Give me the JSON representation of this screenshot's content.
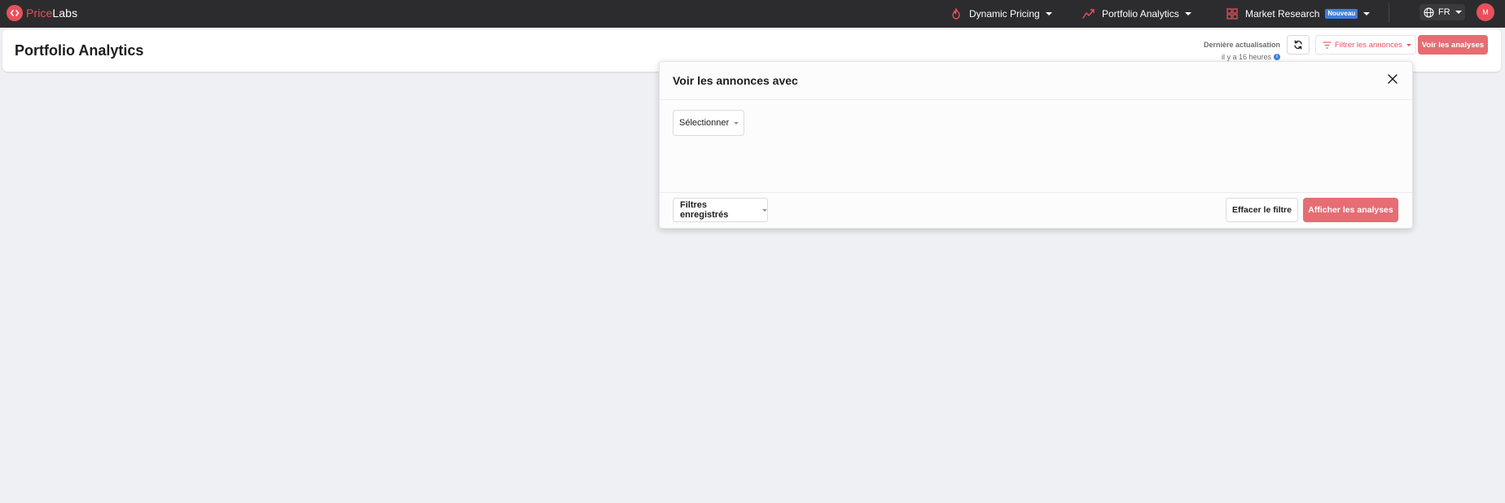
{
  "brand": {
    "name_part1": "Price",
    "name_part2": "Labs",
    "logo_icon": "code-brackets-icon",
    "color": "#e8505b"
  },
  "nav": {
    "items": [
      {
        "label": "Dynamic Pricing",
        "icon": "flame-icon"
      },
      {
        "label": "Portfolio Analytics",
        "icon": "trend-line-icon"
      },
      {
        "label": "Market Research",
        "icon": "grid-icon",
        "badge": "Nouveau"
      }
    ],
    "language": "FR",
    "avatar_initial": "M"
  },
  "header": {
    "title": "Portfolio Analytics",
    "last_update_label": "Dernière actualisation",
    "last_update_time": "il y a 16 heures",
    "info_symbol": "i",
    "filter_label": "Filtrer les annonces",
    "view_label": "Voir les analyses"
  },
  "popover": {
    "title": "Voir les annonces avec",
    "select_label": "Sélectionner",
    "saved_filters_label": "Filtres enregistrés",
    "clear_label": "Effacer le filtre",
    "show_label": "Afficher les analyses"
  },
  "colors": {
    "accent": "#e8505b",
    "accent_button": "#e56d73",
    "navbar": "#2c2c2e",
    "badge": "#3d7fe0",
    "background": "#eff0f3"
  }
}
